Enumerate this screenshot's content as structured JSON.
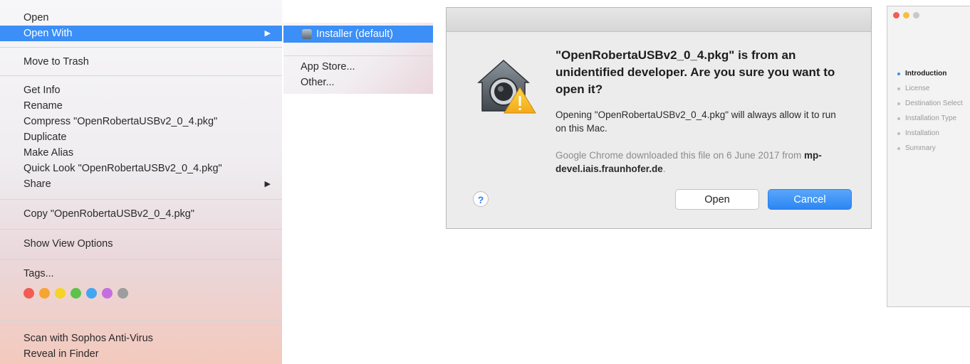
{
  "context_menu": {
    "items": [
      {
        "label": "Open"
      },
      {
        "label": "Open With",
        "highlighted": true,
        "arrow": "▶"
      },
      {
        "label": "Move to Trash"
      },
      {
        "label": "Get Info"
      },
      {
        "label": "Rename"
      },
      {
        "label": "Compress \"OpenRobertaUSBv2_0_4.pkg\""
      },
      {
        "label": "Duplicate"
      },
      {
        "label": "Make Alias"
      },
      {
        "label": "Quick Look \"OpenRobertaUSBv2_0_4.pkg\""
      },
      {
        "label": "Share",
        "arrow": "▶"
      },
      {
        "label": "Copy \"OpenRobertaUSBv2_0_4.pkg\""
      },
      {
        "label": "Show View Options"
      },
      {
        "label": "Tags..."
      },
      {
        "label": "Scan with Sophos Anti-Virus"
      },
      {
        "label": "Reveal in Finder"
      }
    ],
    "tag_colors": [
      "#f25c54",
      "#f7a531",
      "#f5d327",
      "#5cc24a",
      "#43a6f2",
      "#c46fe0",
      "#9d9d9d"
    ]
  },
  "submenu": {
    "items": [
      {
        "label": "Installer (default)",
        "highlighted": true
      },
      {
        "label": "App Store..."
      },
      {
        "label": "Other..."
      }
    ]
  },
  "dialog": {
    "title": "\"OpenRobertaUSBv2_0_4.pkg\" is from an unidentified developer. Are you sure you want to open it?",
    "body": "Opening \"OpenRobertaUSBv2_0_4.pkg\" will always allow it to run on this Mac.",
    "download_note": "Google Chrome downloaded this file on 6 June 2017 from",
    "download_domain": "mp-devel.iais.fraunhofer.de",
    "download_end": ".",
    "help_label": "?",
    "open_label": "Open",
    "cancel_label": "Cancel",
    "accent": "#2c86f3"
  },
  "installer": {
    "traffic_lights": [
      "#f05c56",
      "#f6be3b",
      "#c8c8c8"
    ],
    "steps": [
      {
        "label": "Introduction",
        "active": true
      },
      {
        "label": "License"
      },
      {
        "label": "Destination Select"
      },
      {
        "label": "Installation Type"
      },
      {
        "label": "Installation"
      },
      {
        "label": "Summary"
      }
    ]
  }
}
